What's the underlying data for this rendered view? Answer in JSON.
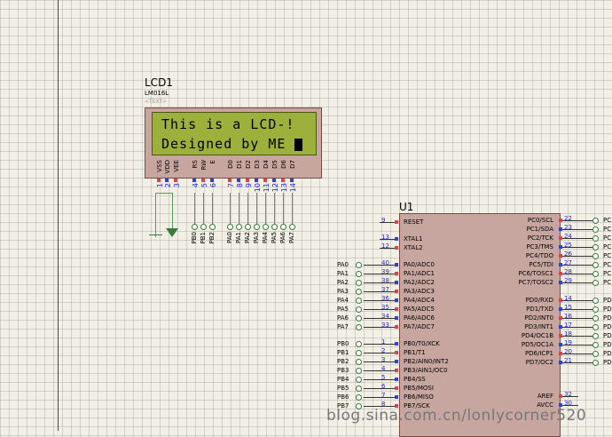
{
  "lcd": {
    "ref": "LCD1",
    "model": "LM016L",
    "text_placeholder": "<TEXT>",
    "line1": "This is a LCD-!",
    "line2": "Designed by ME",
    "pins": [
      {
        "num": "1",
        "name": "VSS"
      },
      {
        "num": "2",
        "name": "VDD"
      },
      {
        "num": "3",
        "name": "VEE"
      },
      {
        "num": "4",
        "name": "RS"
      },
      {
        "num": "5",
        "name": "RW"
      },
      {
        "num": "6",
        "name": "E"
      },
      {
        "num": "7",
        "name": "D0"
      },
      {
        "num": "8",
        "name": "D1"
      },
      {
        "num": "9",
        "name": "D2"
      },
      {
        "num": "10",
        "name": "D3"
      },
      {
        "num": "11",
        "name": "D4"
      },
      {
        "num": "12",
        "name": "D5"
      },
      {
        "num": "13",
        "name": "D6"
      },
      {
        "num": "14",
        "name": "D7"
      }
    ],
    "nets": [
      "PB0",
      "PB1",
      "PB2",
      "PA0",
      "PA1",
      "PA2",
      "PA3",
      "PA4",
      "PA5",
      "PA6",
      "PA7"
    ]
  },
  "chip": {
    "ref": "U1",
    "left_pins": [
      {
        "num": "9",
        "name": "RESET"
      },
      {
        "num": "13",
        "name": "XTAL1"
      },
      {
        "num": "12",
        "name": "XTAL2"
      },
      {
        "num": "40",
        "name": "PA0/ADC0",
        "net": "PA0"
      },
      {
        "num": "39",
        "name": "PA1/ADC1",
        "net": "PA1"
      },
      {
        "num": "38",
        "name": "PA2/ADC2",
        "net": "PA2"
      },
      {
        "num": "37",
        "name": "PA3/ADC3",
        "net": "PA3"
      },
      {
        "num": "36",
        "name": "PA4/ADC4",
        "net": "PA4"
      },
      {
        "num": "35",
        "name": "PA5/ADC5",
        "net": "PA5"
      },
      {
        "num": "34",
        "name": "PA6/ADC6",
        "net": "PA6"
      },
      {
        "num": "33",
        "name": "PA7/ADC7",
        "net": "PA7"
      },
      {
        "num": "1",
        "name": "PB0/T0/XCK",
        "net": "PB0"
      },
      {
        "num": "2",
        "name": "PB1/T1",
        "net": "PB1"
      },
      {
        "num": "3",
        "name": "PB2/AIN0/INT2",
        "net": "PB2"
      },
      {
        "num": "4",
        "name": "PB3/AIN1/OC0",
        "net": "PB3"
      },
      {
        "num": "5",
        "name": "PB4/SS",
        "net": "PB4"
      },
      {
        "num": "6",
        "name": "PB5/MOSI",
        "net": "PB5"
      },
      {
        "num": "7",
        "name": "PB6/MISO",
        "net": "PB6"
      },
      {
        "num": "8",
        "name": "PB7/SCK",
        "net": "PB7"
      }
    ],
    "right_pins": [
      {
        "num": "22",
        "name": "PC0/SCL",
        "net": "PC"
      },
      {
        "num": "23",
        "name": "PC1/SDA",
        "net": "PC"
      },
      {
        "num": "24",
        "name": "PC2/TCK",
        "net": "PC"
      },
      {
        "num": "25",
        "name": "PC3/TMS",
        "net": "PC"
      },
      {
        "num": "26",
        "name": "PC4/TDO",
        "net": "PC"
      },
      {
        "num": "27",
        "name": "PC5/TDI",
        "net": "PC"
      },
      {
        "num": "28",
        "name": "PC6/TOSC1",
        "net": "PC"
      },
      {
        "num": "29",
        "name": "PC7/TOSC2",
        "net": "PC"
      },
      {
        "num": "14",
        "name": "PD0/RXD",
        "net": "PD"
      },
      {
        "num": "15",
        "name": "PD1/TXD",
        "net": "PD"
      },
      {
        "num": "16",
        "name": "PD2/INT0",
        "net": "PD"
      },
      {
        "num": "17",
        "name": "PD3/INT1",
        "net": "PD"
      },
      {
        "num": "18",
        "name": "PD4/OC1B",
        "net": "PD"
      },
      {
        "num": "19",
        "name": "PD5/OC1A",
        "net": "PD"
      },
      {
        "num": "20",
        "name": "PD6/ICP1",
        "net": "PD"
      },
      {
        "num": "21",
        "name": "PD7/OC2",
        "net": "PD"
      },
      {
        "num": "32",
        "name": "AREF"
      },
      {
        "num": "30",
        "name": "AVCC"
      }
    ]
  },
  "watermark": "blog.sina.com.cn/lonlycorner520"
}
